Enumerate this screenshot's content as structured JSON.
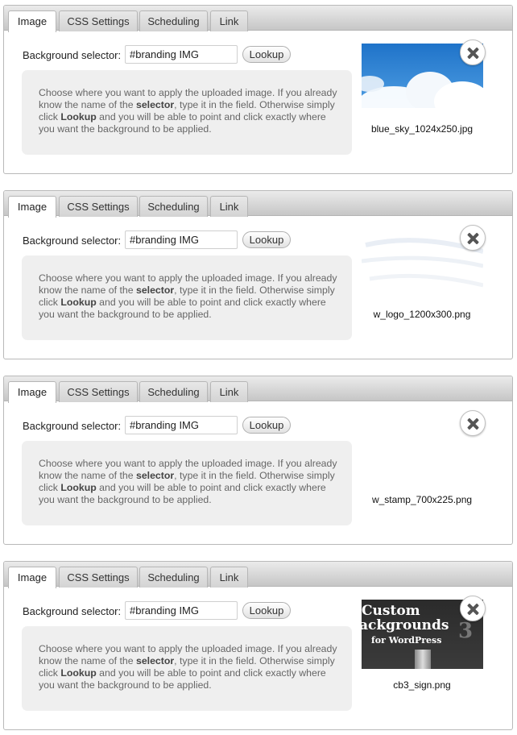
{
  "tabs": [
    "Image",
    "CSS Settings",
    "Scheduling",
    "Link"
  ],
  "selector_label": "Background selector:",
  "selector_value": "#branding IMG",
  "lookup_label": "Lookup",
  "help": {
    "t1": "Choose where you want to apply the uploaded image. If you already know the name of the ",
    "b1": "selector",
    "t2": ", type it in the field. Otherwise simply click ",
    "b2": "Lookup",
    "t3": " and you will be able to point and click exactly where you want the background to be applied."
  },
  "panels": [
    {
      "filename": "blue_sky_1024x250.jpg",
      "thumb": "sky"
    },
    {
      "filename": "w_logo_1200x300.png",
      "thumb": "faint"
    },
    {
      "filename": "w_stamp_700x225.png",
      "thumb": "none"
    },
    {
      "filename": "cb3_sign.png",
      "thumb": "cb3",
      "sign_text": [
        "Custom",
        "ackgrounds",
        "for WordPress",
        "3"
      ]
    }
  ],
  "colors": {
    "tab_bar_top": "#ebebeb",
    "tab_bar_bottom": "#c6c6c6",
    "help_box_bg": "#efefef",
    "sky_blue": "#2f86d6"
  }
}
